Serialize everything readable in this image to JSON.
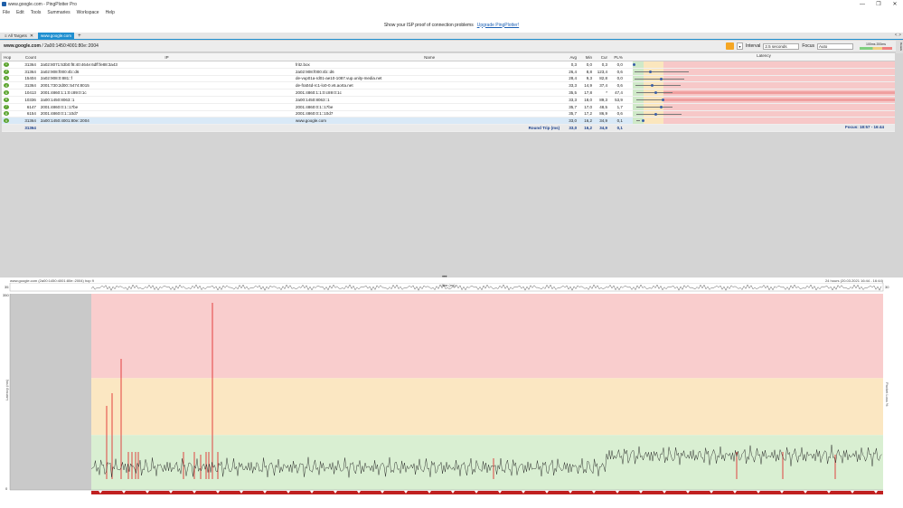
{
  "window": {
    "title": "www.google.com - PingPlotter Pro",
    "minimize": "—",
    "maximize": "❐",
    "close": "✕"
  },
  "menu": [
    "File",
    "Edit",
    "Tools",
    "Summaries",
    "Workspace",
    "Help"
  ],
  "banner": {
    "text": "Show your ISP proof of connection problems",
    "link": "Upgrade PingPlotter!"
  },
  "tabs": {
    "all_targets": "All Targets",
    "active": "www.google.com",
    "add": "+",
    "nav": "< >"
  },
  "toolbar": {
    "host": "www.google.com",
    "ip": " / 2a00:1450:4001:80e::2004",
    "interval_label": "Interval",
    "interval_value": "2.5 seconds",
    "focus_label": "Focus",
    "focus_value": "Auto",
    "legend_text": "100ms    200ms",
    "side_tab": "Details"
  },
  "columns": {
    "hop": "Hop",
    "count": "Count",
    "ip": "IP",
    "name": "Name",
    "avg": "Avg",
    "min": "Min",
    "cur": "Cur",
    "pl": "PL%",
    "latency": "Latency",
    "lat_zero": "0 ms",
    "lat_max": "1437 ms"
  },
  "rows": [
    {
      "hop": "1",
      "count": "31364",
      "ip": "2a02:8071:53b0:f8:40:464e:6dff:fe88:3a43",
      "name": "fritz.box",
      "avg": "0,3",
      "min": "0,0",
      "cur": "0,3",
      "pl": "0,0"
    },
    {
      "hop": "2",
      "count": "31364",
      "ip": "2a02:908:f000:4b::d6",
      "name": "2a02:908:f000:4b::d6",
      "avg": "26,4",
      "min": "8,8",
      "cur": "123,4",
      "pl": "0,6"
    },
    {
      "hop": "3",
      "count": "15404",
      "ip": "2a02:908:0:881::f",
      "name": "de-vup01a-rd01-ae10-1087.vup.unity-media.net",
      "avg": "28,4",
      "min": "9,3",
      "cur": "82,8",
      "pl": "0,0"
    },
    {
      "hop": "4",
      "count": "31364",
      "ip": "2001:730:2d00::5474:8015",
      "name": "de-fra04d-rc1-lo0-0.v6.aorta.net",
      "avg": "33,3",
      "min": "14,9",
      "cur": "37,4",
      "pl": "0,6"
    },
    {
      "hop": "5",
      "count": "10413",
      "ip": "2001:4860:1:1:0:c89:0:1c",
      "name": "2001:4860:1:1:0:c89:0:1c",
      "avg": "35,5",
      "min": "17,8",
      "cur": "*",
      "pl": "47,4"
    },
    {
      "hop": "6",
      "count": "10336",
      "ip": "2a00:1450:8063::1",
      "name": "2a00:1450:8063::1",
      "avg": "33,3",
      "min": "18,0",
      "cur": "89,3",
      "pl": "53,9"
    },
    {
      "hop": "7",
      "count": "6147",
      "ip": "2001:4860:0:1::17be",
      "name": "2001:4860:0:1::17be",
      "avg": "35,7",
      "min": "17,0",
      "cur": "48,5",
      "pl": "1,7"
    },
    {
      "hop": "8",
      "count": "6154",
      "ip": "2001:4860:0:1::10d7",
      "name": "2001:4860:0:1::10d7",
      "avg": "35,7",
      "min": "17,2",
      "cur": "86,9",
      "pl": "0,6"
    },
    {
      "hop": "9",
      "count": "31364",
      "ip": "2a00:1450:4001:80e::2004",
      "name": "www.google.com",
      "avg": "33,0",
      "min": "16,2",
      "cur": "34,9",
      "pl": "0,1"
    }
  ],
  "summary": {
    "count": "31364",
    "label": "Round Trip (ms)",
    "avg": "33,0",
    "min": "16,2",
    "cur": "34,9",
    "pl": "0,1",
    "focus": "Focus: 18:57 - 16:44"
  },
  "graph": {
    "header_left": "www.google.com (2a00:1450:4001:80e::2004) hop 9",
    "header_right": "24 hours (20.03.2021 16:44 - 16:44)",
    "top_label": "35",
    "top_right": "30",
    "y_max": "350",
    "y_zero": "0",
    "y_label": "Latency (ms)",
    "right_label": "Packet Loss %",
    "jitter_label": "Jitter (ms)",
    "colors": {
      "green": "#d9efd2",
      "yellow": "#fbe7c2",
      "red": "#f9cdcd",
      "gray": "#c9c9c9",
      "line": "#222222",
      "spike": "#e03030"
    }
  }
}
